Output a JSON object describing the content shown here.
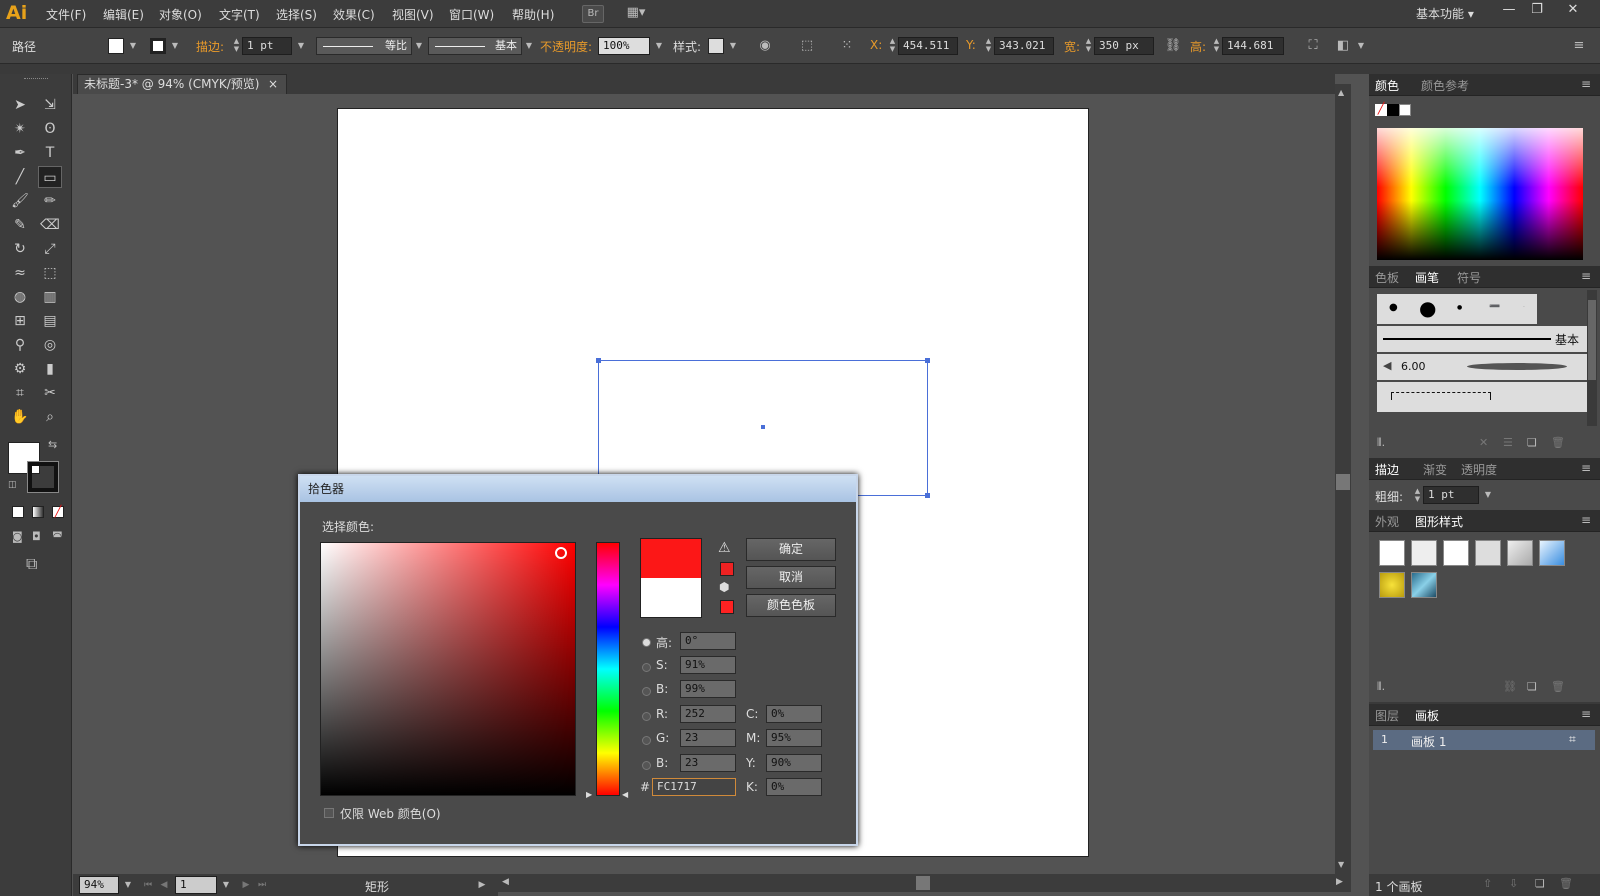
{
  "app": {
    "logo": "Ai",
    "workspace": "基本功能 ▾",
    "bridge_label": "Br",
    "arrange_label": "▦▾"
  },
  "menu": [
    "文件(F)",
    "编辑(E)",
    "对象(O)",
    "文字(T)",
    "选择(S)",
    "效果(C)",
    "视图(V)",
    "窗口(W)",
    "帮助(H)"
  ],
  "control": {
    "object_type": "路径",
    "stroke_label": "描边:",
    "stroke_weight": "1 pt",
    "profile": "等比",
    "brush": "基本",
    "opacity_label": "不透明度:",
    "opacity": "100%",
    "style_label": "样式:",
    "x_label": "X:",
    "x": "454.511",
    "y_label": "Y:",
    "y": "343.021",
    "w_label": "宽:",
    "w": "350 px",
    "h_label": "高:",
    "h": "144.681"
  },
  "document": {
    "tab": "未标题-3* @ 94% (CMYK/预览)",
    "close": "×"
  },
  "status": {
    "zoom": "94%",
    "artboard": "1",
    "tool_name": "矩形"
  },
  "panels": {
    "color_tabs": [
      "颜色",
      "颜色参考"
    ],
    "swatch_tabs": [
      "色板",
      "画笔",
      "符号"
    ],
    "brush_basic": "基本",
    "brush_size": "6.00",
    "stroke_tabs": [
      "描边",
      "渐变",
      "透明度"
    ],
    "weight_label": "粗细:",
    "weight": "1 pt",
    "appearance_tabs": [
      "外观",
      "图形样式"
    ],
    "layer_tabs": [
      "图层",
      "画板"
    ],
    "artboard_row_num": "1",
    "artboard_row_name": "画板 1",
    "artboard_count": "1 个画板"
  },
  "picker": {
    "title": "拾色器",
    "select_label": "选择颜色:",
    "ok": "确定",
    "cancel": "取消",
    "swatches": "颜色色板",
    "h_label": "高:",
    "h": "0°",
    "s_label": "S:",
    "s": "91%",
    "b_label": "B:",
    "b": "99%",
    "r_label": "R:",
    "r": "252",
    "g_label": "G:",
    "g": "23",
    "bb_label": "B:",
    "bb": "23",
    "c_label": "C:",
    "c": "0%",
    "m_label": "M:",
    "m": "95%",
    "yy_label": "Y:",
    "yy": "90%",
    "k_label": "K:",
    "k": "0%",
    "hex_label": "#",
    "hex": "FC1717",
    "web_only": "仅限 Web 颜色(O)",
    "new_color": "#fc1717",
    "old_color": "#ffffff"
  }
}
